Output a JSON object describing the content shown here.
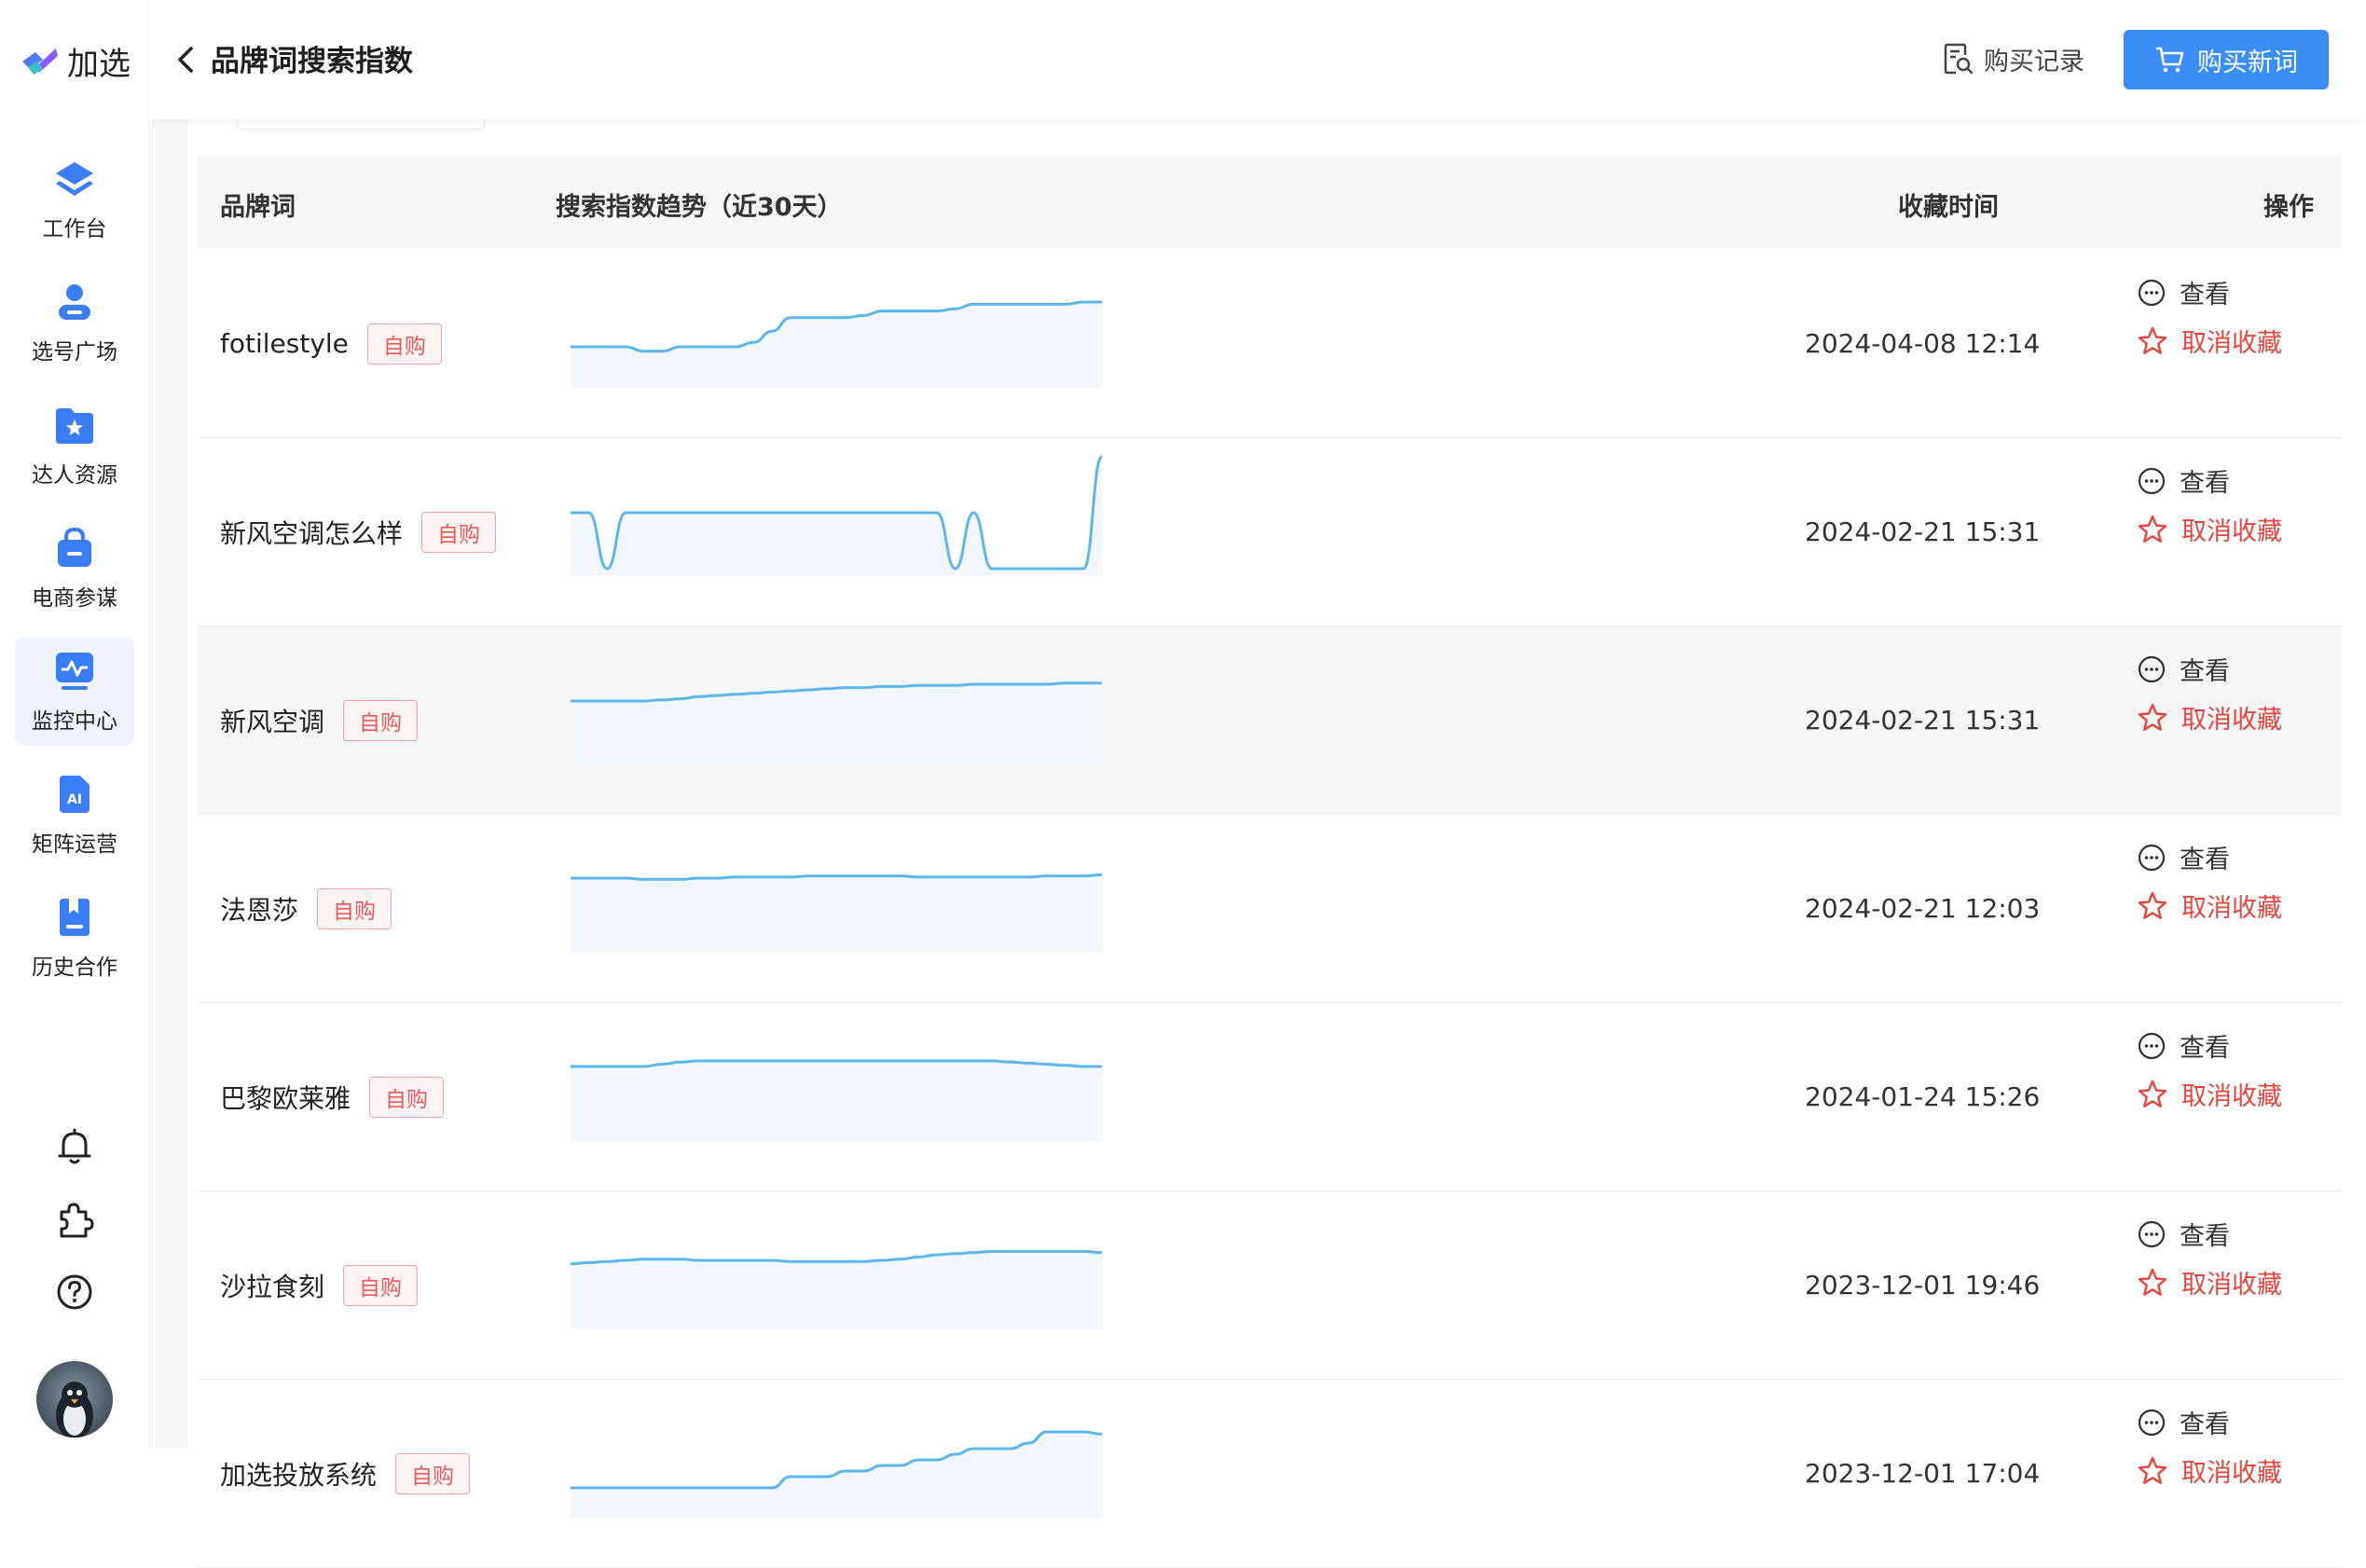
{
  "app": {
    "logo_text": "加选"
  },
  "sidebar": {
    "items": [
      {
        "label": "工作台",
        "icon": "layers-icon"
      },
      {
        "label": "选号广场",
        "icon": "person-icon"
      },
      {
        "label": "达人资源",
        "icon": "star-folder-icon"
      },
      {
        "label": "电商参谋",
        "icon": "shopping-bag-icon"
      },
      {
        "label": "监控中心",
        "icon": "monitor-icon",
        "active": true
      },
      {
        "label": "矩阵运营",
        "icon": "ai-doc-icon"
      },
      {
        "label": "历史合作",
        "icon": "history-doc-icon"
      }
    ],
    "bottom_icons": [
      "bell-icon",
      "puzzle-icon",
      "help-icon"
    ]
  },
  "header": {
    "title": "品牌词搜索指数",
    "records_label": "购买记录",
    "buy_label": "购买新词"
  },
  "table": {
    "columns": [
      "品牌词",
      "搜索指数趋势（近30天）",
      "收藏时间",
      "操作"
    ],
    "view_label": "查看",
    "unfav_label": "取消收藏",
    "rows": [
      {
        "brand": "fotilestyle",
        "tag": "自购",
        "time": "2024-04-08 12:14",
        "trend": [
          30,
          30,
          30,
          30,
          26,
          26,
          30,
          30,
          30,
          30,
          34,
          44,
          56,
          56,
          56,
          56,
          58,
          62,
          62,
          62,
          62,
          64,
          68,
          68,
          68,
          68,
          68,
          68,
          70,
          70
        ]
      },
      {
        "brand": "新风空调怎么样",
        "tag": "自购",
        "time": "2024-02-21 15:31",
        "trend": [
          50,
          50,
          0,
          50,
          50,
          50,
          50,
          50,
          50,
          50,
          50,
          50,
          50,
          50,
          50,
          50,
          50,
          50,
          50,
          50,
          50,
          0,
          50,
          0,
          0,
          0,
          0,
          0,
          0,
          100
        ]
      },
      {
        "brand": "新风空调",
        "tag": "自购",
        "time": "2024-02-21 15:31",
        "trend": [
          50,
          50,
          50,
          50,
          50,
          51,
          52,
          54,
          55,
          56,
          57,
          58,
          59,
          60,
          61,
          62,
          62,
          63,
          63,
          64,
          64,
          64,
          65,
          65,
          65,
          65,
          65,
          66,
          66,
          66
        ]
      },
      {
        "brand": "法恩莎",
        "tag": "自购",
        "time": "2024-02-21 12:03",
        "trend": [
          60,
          60,
          60,
          60,
          59,
          59,
          59,
          60,
          60,
          61,
          61,
          61,
          61,
          62,
          62,
          62,
          62,
          62,
          62,
          61,
          61,
          61,
          61,
          61,
          61,
          61,
          62,
          62,
          62,
          63
        ]
      },
      {
        "brand": "巴黎欧莱雅",
        "tag": "自购",
        "time": "2024-01-24 15:26",
        "trend": [
          60,
          60,
          60,
          60,
          60,
          62,
          64,
          65,
          65,
          65,
          65,
          65,
          65,
          65,
          65,
          65,
          65,
          65,
          65,
          65,
          65,
          65,
          65,
          65,
          64,
          63,
          62,
          61,
          60,
          60
        ]
      },
      {
        "brand": "沙拉食刻",
        "tag": "自购",
        "time": "2023-12-01 19:46",
        "trend": [
          52,
          53,
          54,
          55,
          56,
          56,
          56,
          55,
          55,
          55,
          55,
          55,
          54,
          54,
          54,
          54,
          54,
          55,
          56,
          58,
          60,
          61,
          62,
          63,
          63,
          63,
          63,
          63,
          63,
          62
        ]
      },
      {
        "brand": "加选投放系统",
        "tag": "自购",
        "time": "2023-12-01 17:04",
        "trend": [
          20,
          20,
          20,
          20,
          20,
          20,
          20,
          20,
          20,
          20,
          20,
          20,
          30,
          30,
          30,
          35,
          35,
          40,
          40,
          45,
          45,
          50,
          55,
          55,
          55,
          60,
          70,
          70,
          70,
          68
        ]
      }
    ]
  }
}
